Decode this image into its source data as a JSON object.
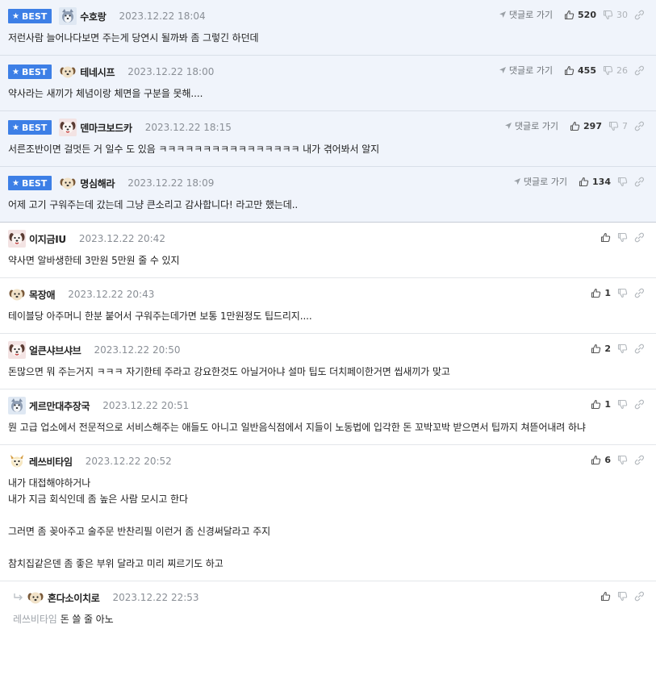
{
  "best_badge_label": "BEST",
  "goto_label": "댓글로 가기",
  "colors": {
    "badge": "#3d7fe6",
    "best_bg": "#f0f4fb"
  },
  "comments": [
    {
      "best": true,
      "avatar": "husky-avatar",
      "nick": "수호랑",
      "date": "2023.12.22 18:04",
      "up": "520",
      "down": "30",
      "body": [
        "저런사람 늘어나다보면 주는게 당연시 될까봐 좀 그렇긴 하던데"
      ]
    },
    {
      "best": true,
      "avatar": "puppy-avatar",
      "nick": "테네시프",
      "date": "2023.12.22 18:00",
      "up": "455",
      "down": "26",
      "body": [
        "약사라는 새끼가 체념이랑 체면을 구분을 못해...."
      ]
    },
    {
      "best": true,
      "avatar": "dog-red-avatar",
      "nick": "덴마크보드카",
      "date": "2023.12.22 18:15",
      "up": "297",
      "down": "7",
      "body": [
        "서른조반이면 걸멋든 거 일수 도 있음 ㅋㅋㅋㅋㅋㅋㅋㅋㅋㅋㅋㅋㅋㅋㅋㅋ 내가 겪어봐서 알지"
      ]
    },
    {
      "best": true,
      "avatar": "puppy-avatar",
      "nick": "명심해라",
      "date": "2023.12.22 18:09",
      "up": "134",
      "down": "",
      "body": [
        "어제 고기 구워주는데 갔는데 그냥 큰소리고 감사합니다! 라고만 했는데.."
      ]
    },
    {
      "best": false,
      "avatar": "dog-red-avatar",
      "nick": "이지금IU",
      "date": "2023.12.22 20:42",
      "up": "",
      "body": [
        "약사면 알바생한테 3만원 5만원 줄 수 있지"
      ]
    },
    {
      "best": false,
      "avatar": "puppy-avatar",
      "nick": "목장애",
      "date": "2023.12.22 20:43",
      "up": "1",
      "body": [
        "테이블당 아주머니 한분 붙어서 구워주는데가면 보통 1만원정도 팁드리지...."
      ]
    },
    {
      "best": false,
      "avatar": "dog-red-avatar",
      "nick": "얼큰샤브샤브",
      "date": "2023.12.22 20:50",
      "up": "2",
      "body": [
        "돈많으면 뭐 주는거지 ㅋㅋㅋ 자기한테 주라고 강요한것도 아닐거아냐 설마 팁도 더치페이한거면 씹새끼가 맞고"
      ]
    },
    {
      "best": false,
      "avatar": "husky-avatar",
      "nick": "게르만대추장국",
      "date": "2023.12.22 20:51",
      "up": "1",
      "body": [
        "뭔 고급 업소에서 전문적으로 서비스해주는 애들도 아니고 일반음식점에서 지들이 노동법에 입각한 돈 꼬박꼬박 받으면서 팁까지 쳐뜯어내려 하냐"
      ]
    },
    {
      "best": false,
      "avatar": "fox-avatar",
      "nick": "레쓰비타임",
      "date": "2023.12.22 20:52",
      "up": "6",
      "body": [
        "내가 대접해야하거나",
        "내가 지금 회식인데 좀 높은 사람 모시고 한다",
        "",
        "그러면 좀 꽂아주고 술주문 반찬리필 이런거 좀 신경써달라고 주지",
        "",
        "참치집같은덴 좀 좋은 부위 달라고 미리 찌르기도 하고"
      ]
    }
  ],
  "reply": {
    "avatar": "puppy-avatar",
    "nick": "혼다소이치로",
    "date": "2023.12.22 22:53",
    "up": "",
    "mention": "레쓰비타임",
    "body": "돈 쓸 줄 아노"
  }
}
